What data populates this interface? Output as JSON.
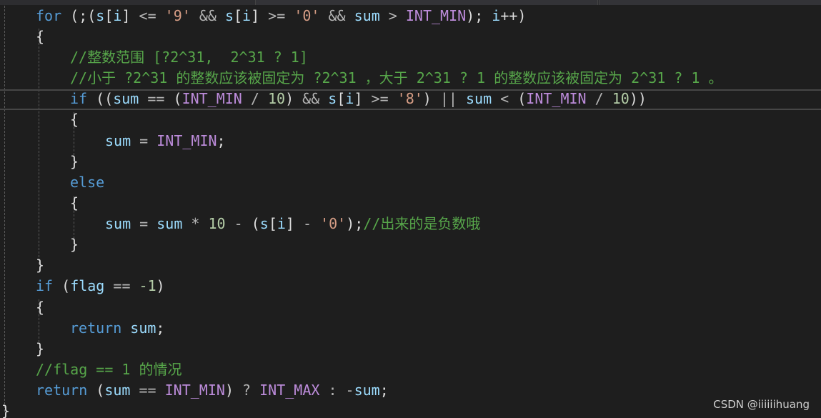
{
  "editor": {
    "lines": [
      {
        "tokens": [
          {
            "t": "for",
            "c": "kw"
          },
          {
            "t": " (;(",
            "c": "pun"
          },
          {
            "t": "s",
            "c": "var"
          },
          {
            "t": "[",
            "c": "pun"
          },
          {
            "t": "i",
            "c": "var"
          },
          {
            "t": "]",
            "c": "pun"
          },
          {
            "t": " <= ",
            "c": "op"
          },
          {
            "t": "'9'",
            "c": "str"
          },
          {
            "t": " && ",
            "c": "op"
          },
          {
            "t": "s",
            "c": "var"
          },
          {
            "t": "[",
            "c": "pun"
          },
          {
            "t": "i",
            "c": "var"
          },
          {
            "t": "]",
            "c": "pun"
          },
          {
            "t": " >= ",
            "c": "op"
          },
          {
            "t": "'0'",
            "c": "str"
          },
          {
            "t": " && ",
            "c": "op"
          },
          {
            "t": "sum",
            "c": "var"
          },
          {
            "t": " > ",
            "c": "op"
          },
          {
            "t": "INT_MIN",
            "c": "mac"
          },
          {
            "t": "); ",
            "c": "pun"
          },
          {
            "t": "i",
            "c": "var"
          },
          {
            "t": "++)",
            "c": "pun"
          }
        ]
      },
      {
        "tokens": [
          {
            "t": "{",
            "c": "pun"
          }
        ]
      },
      {
        "tokens": [
          {
            "t": "//整数范围 [?2^31,  2^31 ? 1]",
            "c": "cmt"
          }
        ]
      },
      {
        "tokens": [
          {
            "t": "//小于 ?2^31 的整数应该被固定为 ?2^31 ，大于 2^31 ? 1 的整数应该被固定为 2^31 ? 1 。",
            "c": "cmt"
          }
        ]
      },
      {
        "tokens": [
          {
            "t": "if",
            "c": "kw"
          },
          {
            "t": " ((",
            "c": "pun"
          },
          {
            "t": "sum",
            "c": "var"
          },
          {
            "t": " == ",
            "c": "op"
          },
          {
            "t": "(",
            "c": "pun"
          },
          {
            "t": "INT_MIN",
            "c": "mac"
          },
          {
            "t": " / ",
            "c": "op"
          },
          {
            "t": "10",
            "c": "num"
          },
          {
            "t": ")",
            "c": "pun"
          },
          {
            "t": " && ",
            "c": "op"
          },
          {
            "t": "s",
            "c": "var"
          },
          {
            "t": "[",
            "c": "pun"
          },
          {
            "t": "i",
            "c": "var"
          },
          {
            "t": "]",
            "c": "pun"
          },
          {
            "t": " >= ",
            "c": "op"
          },
          {
            "t": "'8'",
            "c": "str"
          },
          {
            "t": ")",
            "c": "pun"
          },
          {
            "t": " || ",
            "c": "op"
          },
          {
            "t": "sum",
            "c": "var"
          },
          {
            "t": " < ",
            "c": "op"
          },
          {
            "t": "(",
            "c": "pun"
          },
          {
            "t": "INT_MIN",
            "c": "mac"
          },
          {
            "t": " / ",
            "c": "op"
          },
          {
            "t": "10",
            "c": "num"
          },
          {
            "t": "))",
            "c": "pun"
          }
        ]
      },
      {
        "tokens": [
          {
            "t": "{",
            "c": "pun"
          }
        ]
      },
      {
        "tokens": [
          {
            "t": "sum",
            "c": "var"
          },
          {
            "t": " = ",
            "c": "op"
          },
          {
            "t": "INT_MIN",
            "c": "mac"
          },
          {
            "t": ";",
            "c": "pun"
          }
        ]
      },
      {
        "tokens": [
          {
            "t": "}",
            "c": "pun"
          }
        ]
      },
      {
        "tokens": [
          {
            "t": "else",
            "c": "kw"
          }
        ]
      },
      {
        "tokens": [
          {
            "t": "{",
            "c": "pun"
          }
        ]
      },
      {
        "tokens": [
          {
            "t": "sum",
            "c": "var"
          },
          {
            "t": " = ",
            "c": "op"
          },
          {
            "t": "sum",
            "c": "var"
          },
          {
            "t": " * ",
            "c": "op"
          },
          {
            "t": "10",
            "c": "num"
          },
          {
            "t": " - ",
            "c": "op"
          },
          {
            "t": "(",
            "c": "pun"
          },
          {
            "t": "s",
            "c": "var"
          },
          {
            "t": "[",
            "c": "pun"
          },
          {
            "t": "i",
            "c": "var"
          },
          {
            "t": "]",
            "c": "pun"
          },
          {
            "t": " - ",
            "c": "op"
          },
          {
            "t": "'0'",
            "c": "str"
          },
          {
            "t": ");",
            "c": "pun"
          },
          {
            "t": "//出来的是负数哦",
            "c": "cmt"
          }
        ]
      },
      {
        "tokens": [
          {
            "t": "}",
            "c": "pun"
          }
        ]
      },
      {
        "tokens": [
          {
            "t": "}",
            "c": "pun"
          }
        ]
      },
      {
        "tokens": [
          {
            "t": "if",
            "c": "kw"
          },
          {
            "t": " (",
            "c": "pun"
          },
          {
            "t": "flag",
            "c": "var"
          },
          {
            "t": " == ",
            "c": "op"
          },
          {
            "t": "-1",
            "c": "num"
          },
          {
            "t": ")",
            "c": "pun"
          }
        ]
      },
      {
        "tokens": [
          {
            "t": "{",
            "c": "pun"
          }
        ]
      },
      {
        "tokens": [
          {
            "t": "return",
            "c": "kw"
          },
          {
            "t": " ",
            "c": "pun"
          },
          {
            "t": "sum",
            "c": "var"
          },
          {
            "t": ";",
            "c": "pun"
          }
        ]
      },
      {
        "tokens": [
          {
            "t": "}",
            "c": "pun"
          }
        ]
      },
      {
        "tokens": [
          {
            "t": "//flag == 1 的情况",
            "c": "cmt"
          }
        ]
      },
      {
        "tokens": [
          {
            "t": "return",
            "c": "kw"
          },
          {
            "t": " (",
            "c": "pun"
          },
          {
            "t": "sum",
            "c": "var"
          },
          {
            "t": " == ",
            "c": "op"
          },
          {
            "t": "INT_MIN",
            "c": "mac"
          },
          {
            "t": ") ",
            "c": "pun"
          },
          {
            "t": "? ",
            "c": "op"
          },
          {
            "t": "INT_MAX",
            "c": "mac"
          },
          {
            "t": " : ",
            "c": "op"
          },
          {
            "t": "-",
            "c": "op"
          },
          {
            "t": "sum",
            "c": "var"
          },
          {
            "t": ";",
            "c": "pun"
          }
        ]
      },
      {
        "tokens": [
          {
            "t": "}",
            "c": "pun"
          }
        ]
      }
    ]
  },
  "colors": {
    "background": "#1e1e1e",
    "keyword": "#569cd6",
    "variable": "#9cdcfe",
    "macro": "#bd8cdb",
    "string": "#d69d85",
    "number": "#b5cea8",
    "comment": "#57a64a"
  },
  "watermark": "CSDN @iiiiiihuang"
}
